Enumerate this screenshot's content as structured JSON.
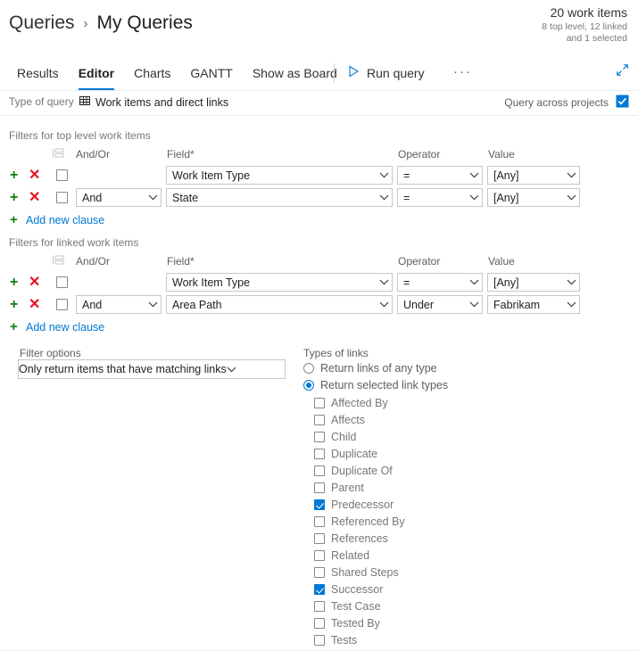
{
  "header": {
    "breadcrumb_root": "Queries",
    "breadcrumb_sep": "›",
    "breadcrumb_current": "My Queries",
    "count_main": "20 work items",
    "count_sub_line1": "8 top level, 12 linked",
    "count_sub_line2": "and 1 selected"
  },
  "tabs": [
    {
      "label": "Results",
      "active": false
    },
    {
      "label": "Editor",
      "active": true
    },
    {
      "label": "Charts",
      "active": false
    },
    {
      "label": "GANTT",
      "active": false
    },
    {
      "label": "Show as Board",
      "active": false
    }
  ],
  "toolbar": {
    "run_query_label": "Run query",
    "overflow_label": "···",
    "play_icon": "play-icon",
    "expand_icon": "expand-icon"
  },
  "query_type": {
    "label": "Type of query",
    "value": "Work items and direct links",
    "icon": "table-grid-icon",
    "across_projects_label": "Query across projects",
    "across_projects_checked": true
  },
  "accent": {
    "blue": "#0078d4",
    "green": "#107c10",
    "red": "#e81123",
    "border": "#c8c6c4"
  },
  "top_filters": {
    "section_title": "Filters for top level work items",
    "columns": {
      "group": "group-icon",
      "andor": "And/Or",
      "field": "Field*",
      "operator": "Operator",
      "value": "Value"
    },
    "rows": [
      {
        "add": "+",
        "del": "✕",
        "checked": false,
        "andor": "",
        "field": "Work Item Type",
        "operator": "=",
        "value": "[Any]"
      },
      {
        "add": "+",
        "del": "✕",
        "checked": false,
        "andor": "And",
        "field": "State",
        "operator": "=",
        "value": "[Any]"
      }
    ],
    "add_clause_label": "Add new clause",
    "add_clause_plus": "+"
  },
  "linked_filters": {
    "section_title": "Filters for linked work items",
    "columns": {
      "group": "group-icon",
      "andor": "And/Or",
      "field": "Field*",
      "operator": "Operator",
      "value": "Value"
    },
    "rows": [
      {
        "add": "+",
        "del": "✕",
        "checked": false,
        "andor": "",
        "field": "Work Item Type",
        "operator": "=",
        "value": "[Any]"
      },
      {
        "add": "+",
        "del": "✕",
        "checked": false,
        "andor": "And",
        "field": "Area Path",
        "operator": "Under",
        "value": "Fabrikam"
      }
    ],
    "add_clause_label": "Add new clause",
    "add_clause_plus": "+"
  },
  "filter_options": {
    "label": "Filter options",
    "value": "Only return items that have matching links"
  },
  "types_of_links": {
    "label": "Types of links",
    "radios": [
      {
        "label": "Return links of any type",
        "selected": false
      },
      {
        "label": "Return selected link types",
        "selected": true
      }
    ],
    "items": [
      {
        "label": "Affected By",
        "checked": false
      },
      {
        "label": "Affects",
        "checked": false
      },
      {
        "label": "Child",
        "checked": false
      },
      {
        "label": "Duplicate",
        "checked": false
      },
      {
        "label": "Duplicate Of",
        "checked": false
      },
      {
        "label": "Parent",
        "checked": false
      },
      {
        "label": "Predecessor",
        "checked": true
      },
      {
        "label": "Referenced By",
        "checked": false
      },
      {
        "label": "References",
        "checked": false
      },
      {
        "label": "Related",
        "checked": false
      },
      {
        "label": "Shared Steps",
        "checked": false
      },
      {
        "label": "Successor",
        "checked": true
      },
      {
        "label": "Test Case",
        "checked": false
      },
      {
        "label": "Tested By",
        "checked": false
      },
      {
        "label": "Tests",
        "checked": false
      }
    ]
  }
}
